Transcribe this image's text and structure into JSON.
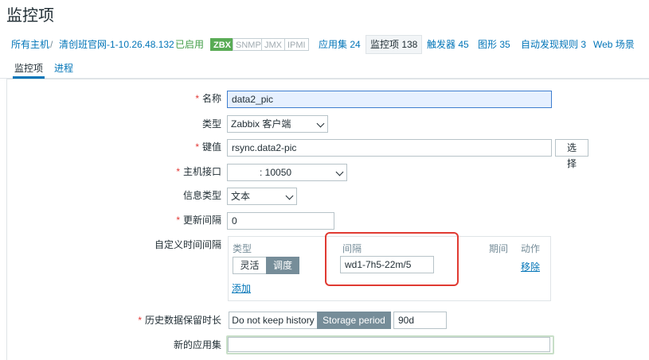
{
  "page": {
    "title": "监控项"
  },
  "breadcrumb": {
    "all_hosts": "所有主机",
    "separator": "/",
    "host": "清创班官网-1-10.26.48.132",
    "status": "已启用",
    "badges": {
      "zbx": "ZBX",
      "snmp": "SNMP",
      "jmx": "JMX",
      "ipmi": "IPMI"
    },
    "links": {
      "apps": "应用集 24",
      "items": "监控项 138",
      "triggers": "触发器 45",
      "graphs": "图形 35",
      "discovery": "自动发现规则 3",
      "web": "Web 场景"
    }
  },
  "tabs": {
    "item": "监控项",
    "process": "进程"
  },
  "form": {
    "required_mark": "*",
    "name": {
      "label": "名称",
      "value": "data2_pic"
    },
    "type": {
      "label": "类型",
      "value": "Zabbix 客户端"
    },
    "key": {
      "label": "键值",
      "value": "rsync.data2-pic",
      "select_button": "选择"
    },
    "interface": {
      "label": "主机接口",
      "value": ": 10050"
    },
    "info_type": {
      "label": "信息类型",
      "value": "文本"
    },
    "update_interval": {
      "label": "更新间隔",
      "value": "0"
    },
    "custom_intervals": {
      "label": "自定义时间间隔",
      "col_type": "类型",
      "col_interval": "间隔",
      "col_period": "期间",
      "col_action": "动作",
      "type_flexible": "灵活",
      "type_scheduling": "调度",
      "interval_value": "wd1-7h5-22m/5",
      "remove": "移除",
      "add": "添加"
    },
    "history": {
      "label": "历史数据保留时长",
      "no_keep": "Do not keep history",
      "storage_period": "Storage period",
      "value": "90d"
    },
    "new_app": {
      "label": "新的应用集",
      "value": ""
    }
  },
  "colors": {
    "accent": "#0275b8",
    "enabled": "#429e47",
    "required": "#e33734",
    "highlight_box": "#e03a32"
  }
}
